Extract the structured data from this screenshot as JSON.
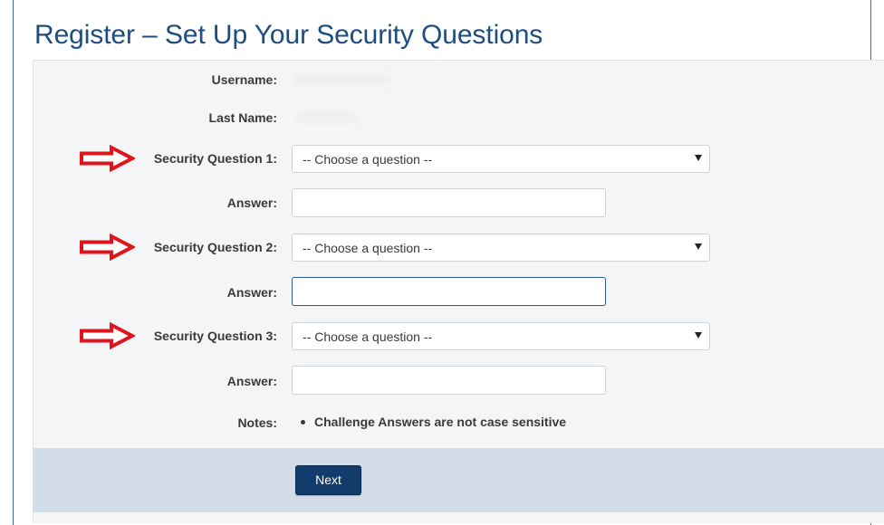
{
  "title": "Register – Set Up Your Security Questions",
  "fields": {
    "username_label": "Username:",
    "last_name_label": "Last Name:",
    "question1_label": "Security Question 1:",
    "question1_value": "-- Choose a question --",
    "answer1_label": "Answer:",
    "answer1_value": "",
    "question2_label": "Security Question 2:",
    "question2_value": "-- Choose a question --",
    "answer2_label": "Answer:",
    "answer2_value": "",
    "question3_label": "Security Question 3:",
    "question3_value": "-- Choose a question --",
    "answer3_label": "Answer:",
    "answer3_value": "",
    "notes_label": "Notes:",
    "notes_items": [
      "Challenge Answers are not case sensitive"
    ]
  },
  "buttons": {
    "next_label": "Next"
  },
  "icons": {
    "annotation_arrow": "right-arrow-icon",
    "dropdown_caret": "caret-down-icon"
  },
  "colors": {
    "title": "#1e4d7f",
    "panel_background": "#f4f5f6",
    "footer_bar": "#d2dde7",
    "next_button": "#133b6b",
    "annotation_arrow": "#e0141c",
    "focus_border": "#2b5a8e"
  }
}
